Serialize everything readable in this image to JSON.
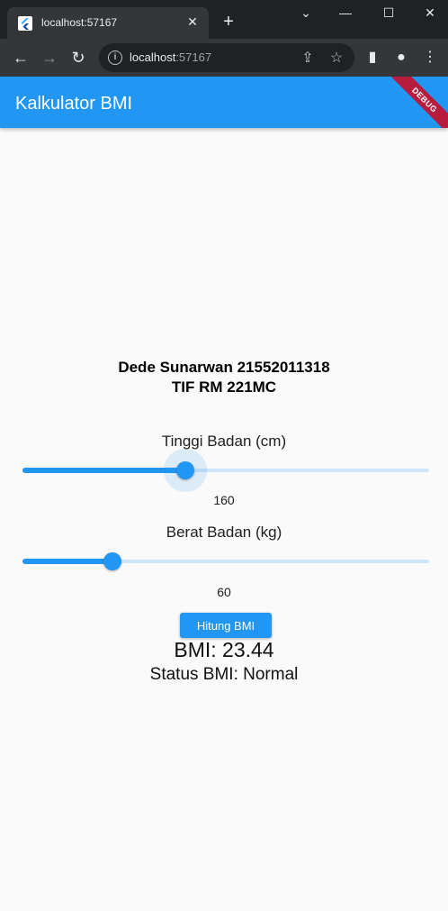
{
  "browser": {
    "tab_title": "localhost:57167",
    "url_host": "localhost",
    "url_port": ":57167"
  },
  "app": {
    "title": "Kalkulator BMI",
    "debug_banner": "DEBUG"
  },
  "main": {
    "name_line1": "Dede Sunarwan 21552011318",
    "name_line2": "TIF RM 221MC",
    "height_label": "Tinggi Badan (cm)",
    "height_value": "160",
    "height_fraction": 0.4,
    "weight_label": "Berat Badan (kg)",
    "weight_value": "60",
    "weight_fraction": 0.222,
    "button_label": "Hitung BMI",
    "bmi_text": "BMI: 23.44",
    "status_text": "Status BMI: Normal"
  },
  "colors": {
    "primary": "#2196f3",
    "track_inactive": "#cfe5fb",
    "debug_banner": "#b71c3d"
  }
}
